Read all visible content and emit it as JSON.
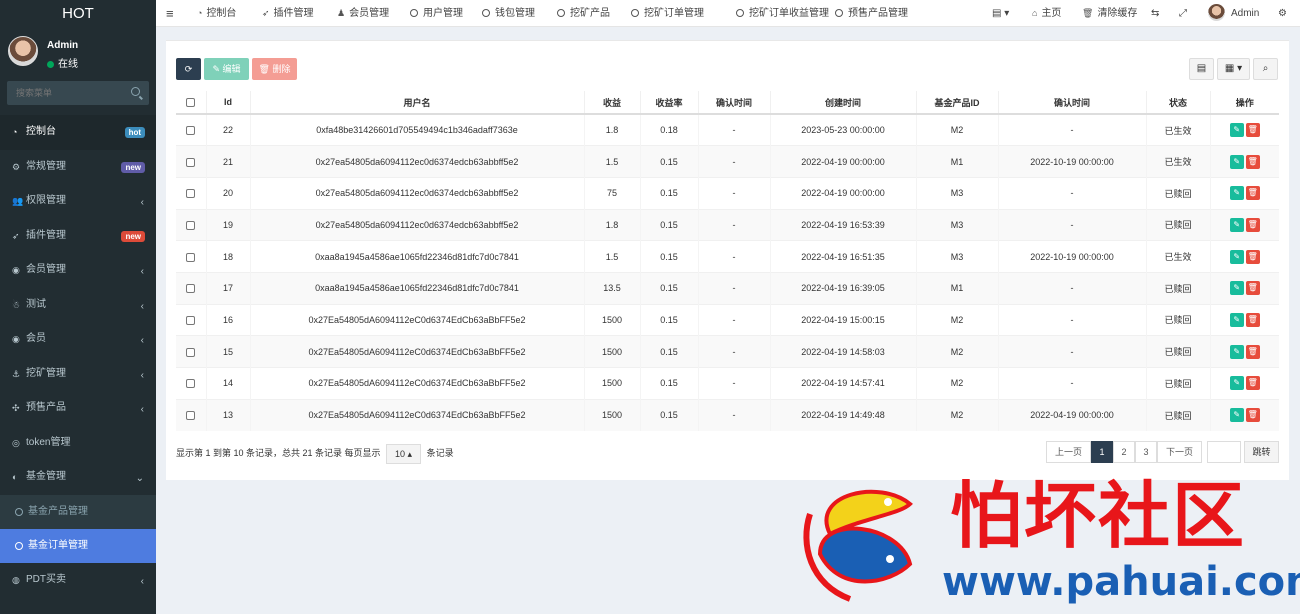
{
  "app": {
    "logo": "HOT"
  },
  "user": {
    "name": "Admin",
    "status": "在线"
  },
  "search": {
    "placeholder": "搜索菜单"
  },
  "sidebar": {
    "items": [
      {
        "label": "控制台",
        "icon": "dashboard-icon",
        "badge": "hot",
        "badge_color": "#3c8dbc",
        "active": true
      },
      {
        "label": "常规管理",
        "icon": "cogs-icon",
        "badge": "new",
        "badge_color": "#605ca8"
      },
      {
        "label": "权限管理",
        "icon": "group-icon",
        "arrow": "‹"
      },
      {
        "label": "插件管理",
        "icon": "rocket-icon",
        "badge": "new",
        "badge_color": "#dd4b39"
      },
      {
        "label": "会员管理",
        "icon": "user-circle-icon",
        "arrow": "‹"
      },
      {
        "label": "测试",
        "icon": "test-icon",
        "arrow": "‹"
      },
      {
        "label": "会员",
        "icon": "user-circle-icon",
        "arrow": "‹"
      },
      {
        "label": "挖矿管理",
        "icon": "anchor-icon",
        "arrow": "‹"
      },
      {
        "label": "预售产品",
        "icon": "puzzle-icon",
        "arrow": "‹"
      },
      {
        "label": "token管理",
        "icon": "token-icon"
      },
      {
        "label": "基金管理",
        "icon": "adjust-icon",
        "arrow": "⌄",
        "expanded": true
      }
    ],
    "fund_sub": [
      {
        "label": "基金产品管理"
      },
      {
        "label": "基金订单管理",
        "selected": true
      }
    ],
    "after": [
      {
        "label": "PDT买卖",
        "icon": "pdt-icon",
        "arrow": "‹"
      }
    ]
  },
  "topnav": {
    "menu_icon": "≡",
    "items": [
      {
        "label": "控制台",
        "icon": "dashboard-icon"
      },
      {
        "label": "插件管理",
        "icon": "rocket-icon"
      },
      {
        "label": "会员管理",
        "icon": "user-icon"
      },
      {
        "label": "用户管理",
        "icon": "circle-icon"
      },
      {
        "label": "钱包管理",
        "icon": "circle-icon"
      },
      {
        "label": "挖矿产品",
        "icon": "circle-icon"
      },
      {
        "label": "挖矿订单管理",
        "icon": "circle-icon"
      },
      {
        "label": "挖矿订单收益管理",
        "icon": "circle-icon"
      },
      {
        "label": "预售产品管理",
        "icon": "circle-icon"
      }
    ],
    "right": {
      "home": "主页",
      "clear_cache": "清除缓存",
      "admin": "Admin"
    }
  },
  "toolbar": {
    "refresh": "⟳",
    "edit": "✎ 编辑",
    "delete": "🗑 删除"
  },
  "table": {
    "headers": [
      "",
      "Id",
      "用户名",
      "收益",
      "收益率",
      "确认时间",
      "创建时间",
      "基金产品ID",
      "确认时间",
      "状态",
      "操作"
    ],
    "rows": [
      [
        "22",
        "0xfa48be31426601d705549494c1b346adaff7363e",
        "1.8",
        "0.18",
        "-",
        "2023-05-23 00:00:00",
        "M2",
        "-",
        "已生效"
      ],
      [
        "21",
        "0x27ea54805da6094112ec0d6374edcb63abbff5e2",
        "1.5",
        "0.15",
        "-",
        "2022-04-19 00:00:00",
        "M1",
        "2022-10-19 00:00:00",
        "已生效"
      ],
      [
        "20",
        "0x27ea54805da6094112ec0d6374edcb63abbff5e2",
        "75",
        "0.15",
        "-",
        "2022-04-19 00:00:00",
        "M3",
        "-",
        "已赎回"
      ],
      [
        "19",
        "0x27ea54805da6094112ec0d6374edcb63abbff5e2",
        "1.8",
        "0.15",
        "-",
        "2022-04-19 16:53:39",
        "M3",
        "-",
        "已赎回"
      ],
      [
        "18",
        "0xaa8a1945a4586ae1065fd22346d81dfc7d0c7841",
        "1.5",
        "0.15",
        "-",
        "2022-04-19 16:51:35",
        "M3",
        "2022-10-19 00:00:00",
        "已生效"
      ],
      [
        "17",
        "0xaa8a1945a4586ae1065fd22346d81dfc7d0c7841",
        "13.5",
        "0.15",
        "-",
        "2022-04-19 16:39:05",
        "M1",
        "-",
        "已赎回"
      ],
      [
        "16",
        "0x27Ea54805dA6094112eC0d6374EdCb63aBbFF5e2",
        "1500",
        "0.15",
        "-",
        "2022-04-19 15:00:15",
        "M2",
        "-",
        "已赎回"
      ],
      [
        "15",
        "0x27Ea54805dA6094112eC0d6374EdCb63aBbFF5e2",
        "1500",
        "0.15",
        "-",
        "2022-04-19 14:58:03",
        "M2",
        "-",
        "已赎回"
      ],
      [
        "14",
        "0x27Ea54805dA6094112eC0d6374EdCb63aBbFF5e2",
        "1500",
        "0.15",
        "-",
        "2022-04-19 14:57:41",
        "M2",
        "-",
        "已赎回"
      ],
      [
        "13",
        "0x27Ea54805dA6094112eC0d6374EdCb63aBbFF5e2",
        "1500",
        "0.15",
        "-",
        "2022-04-19 14:49:48",
        "M2",
        "2022-04-19 00:00:00",
        "已赎回"
      ]
    ]
  },
  "footer": {
    "info": "显示第 1 到第 10 条记录，总共 21 条记录 每页显示",
    "page_size": "10 ▴",
    "suffix": "条记录"
  },
  "pagination": {
    "prev": "上一页",
    "pages": [
      "1",
      "2",
      "3"
    ],
    "next": "下一页",
    "jump": "跳转"
  },
  "watermark": {
    "cn": "怕坏社区",
    "url": "www.pahuai.com"
  }
}
